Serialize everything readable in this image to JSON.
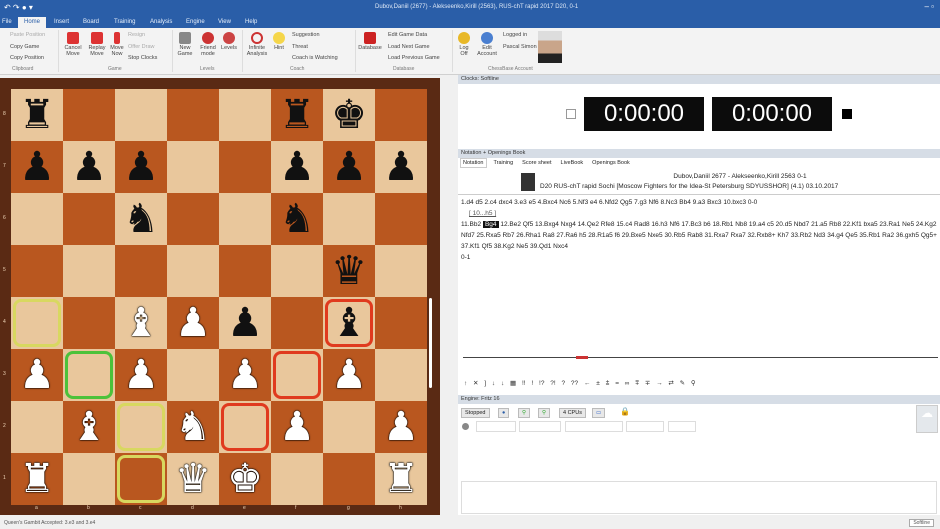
{
  "window": {
    "title": "Dubov,Daniil (2677) - Alekseenko,Kirill (2563), RUS-chT rapid 2017  D20, 0-1"
  },
  "tabs": [
    "File",
    "Home",
    "Insert",
    "Board",
    "Training",
    "Analysis",
    "Engine",
    "View",
    "Help"
  ],
  "ribbon": {
    "clipboard": {
      "items": [
        "Paste Position",
        "Copy Game",
        "Copy Position"
      ],
      "label": "Clipboard"
    },
    "game": {
      "items": [
        "Cancel Move",
        "Replay Move",
        "Move Now",
        "Resign",
        "Offer Draw",
        "Stop Clocks"
      ],
      "label": "Game"
    },
    "levels": {
      "items": [
        "New Game",
        "Friend mode",
        "Levels"
      ],
      "label": "Levels"
    },
    "coach": {
      "items": [
        "Infinite Analysis",
        "Hint",
        "Suggestion",
        "Threat",
        "Coach is Watching"
      ],
      "label": "Coach"
    },
    "database": {
      "items": [
        "Database",
        "Edit Game Data",
        "Load Next Game",
        "Load Previous Game"
      ],
      "label": "Database"
    },
    "account": {
      "items": [
        "Log Off",
        "Edit Account",
        "Logged in",
        "Pascal Simon"
      ],
      "label": "ChessBase Account"
    }
  },
  "board": {
    "ranks": [
      "8",
      "7",
      "6",
      "5",
      "4",
      "3",
      "2",
      "1"
    ],
    "files": [
      "a",
      "b",
      "c",
      "d",
      "e",
      "f",
      "g",
      "h"
    ],
    "pieces": [
      {
        "sq": "a8",
        "p": "♜",
        "c": "b"
      },
      {
        "sq": "f8",
        "p": "♜",
        "c": "b"
      },
      {
        "sq": "g8",
        "p": "♚",
        "c": "b"
      },
      {
        "sq": "a7",
        "p": "♟",
        "c": "b"
      },
      {
        "sq": "b7",
        "p": "♟",
        "c": "b"
      },
      {
        "sq": "c7",
        "p": "♟",
        "c": "b"
      },
      {
        "sq": "f7",
        "p": "♟",
        "c": "b"
      },
      {
        "sq": "g7",
        "p": "♟",
        "c": "b"
      },
      {
        "sq": "h7",
        "p": "♟",
        "c": "b"
      },
      {
        "sq": "c6",
        "p": "♞",
        "c": "b"
      },
      {
        "sq": "f6",
        "p": "♞",
        "c": "b"
      },
      {
        "sq": "g5",
        "p": "♛",
        "c": "b"
      },
      {
        "sq": "c4",
        "p": "♝",
        "c": "w"
      },
      {
        "sq": "d4",
        "p": "♟",
        "c": "w"
      },
      {
        "sq": "e4",
        "p": "♟",
        "c": "b"
      },
      {
        "sq": "g4",
        "p": "♝",
        "c": "b"
      },
      {
        "sq": "a3",
        "p": "♟",
        "c": "w"
      },
      {
        "sq": "c3",
        "p": "♟",
        "c": "w"
      },
      {
        "sq": "e3",
        "p": "♟",
        "c": "w"
      },
      {
        "sq": "g3",
        "p": "♟",
        "c": "w"
      },
      {
        "sq": "b2",
        "p": "♝",
        "c": "w"
      },
      {
        "sq": "d2",
        "p": "♞",
        "c": "w"
      },
      {
        "sq": "f2",
        "p": "♟",
        "c": "w"
      },
      {
        "sq": "h2",
        "p": "♟",
        "c": "w"
      },
      {
        "sq": "a1",
        "p": "♜",
        "c": "w"
      },
      {
        "sq": "d1",
        "p": "♛",
        "c": "w"
      },
      {
        "sq": "e1",
        "p": "♚",
        "c": "w"
      },
      {
        "sq": "h1",
        "p": "♜",
        "c": "w"
      }
    ],
    "highlights": [
      {
        "sq": "a4",
        "color": "#d8d860"
      },
      {
        "sq": "b3",
        "color": "#4cc23a"
      },
      {
        "sq": "c2",
        "color": "#d8d860"
      },
      {
        "sq": "c1",
        "color": "#d8d860"
      },
      {
        "sq": "e2",
        "color": "#e03a1e"
      },
      {
        "sq": "f3",
        "color": "#e03a1e"
      },
      {
        "sq": "g4",
        "color": "#e03a1e"
      }
    ]
  },
  "clocks": {
    "title": "Clocks: Softline",
    "white": "0:00:00",
    "black": "0:00:00"
  },
  "notation": {
    "panel_title": "Notation + Openings Book",
    "tabs": [
      "Notation",
      "Training",
      "Score sheet",
      "LiveBook",
      "Openings Book"
    ],
    "players": "Dubov,Daniil 2677 - Alekseenko,Kirill 2563  0-1",
    "event": "D20 RUS-chT rapid Sochi [Moscow Fighters for the Idea-St Petersburg SDYUSSHOR] (4.1) 03.10.2017",
    "line1": "1.d4  d5  2.c4  dxc4  3.e3  e5  4.Bxc4  Nc6  5.Nf3  e4  6.Nfd2  Qg5  7.g3  Nf6  8.Nc3  Bb4  9.a3  Bxc3  10.bxc3  0-0",
    "variation": "[ 10...h5 ]",
    "line2_pre": "11.Bb2",
    "current": "Bg4",
    "line2_post": "12.Be2  Qf5  13.Bxg4  Nxg4  14.Qe2  Rfe8  15.c4  Rad8  16.h3  Nf6  17.Bc3  b6  18.Rb1  Nb8  19.a4  c5  20.d5  Nbd7  21.a5  Rb8  22.Kf1  bxa5  23.Ra1  Ne5  24.Kg2  Nfd7  25.Rxa5  Rb7  26.Rha1  Ra8  27.Ra6  h5  28.R1a5  f6  29.Bxe5  Nxe5  30.Rb5  Rab8  31.Rxa7  Rxa7  32.Rxb8+  Kh7  33.Rb2  Nd3  34.g4  Qe5  35.Rb1  Ra2  36.gxh5  Qg5+  37.Kf1  Qf5  38.Kg2  Ne5  39.Qd1  Nxc4",
    "result": "0-1",
    "symbols": "↑ ✕ ] ↓ ↓ ▦ !! ! !? ?! ? ?? ← ± ⩲ = ∞ ⩱ ∓ → ⇄ ✎ ⚲"
  },
  "engine": {
    "panel_title": "Engine: Fritz 16",
    "status": "Stopped",
    "cpus": "4 CPUs"
  },
  "statusbar": {
    "text": "Queen's Gambit Accepted: 3.e3 and 3.e4",
    "zoom": "Softline"
  }
}
